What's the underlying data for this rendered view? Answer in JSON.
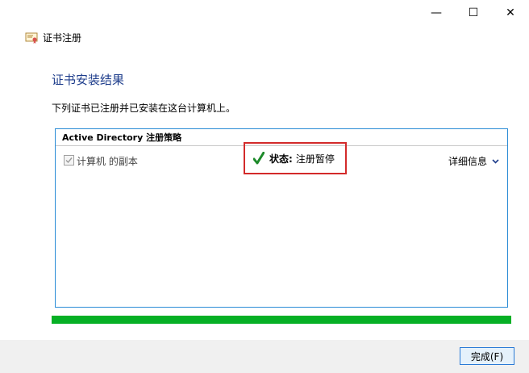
{
  "window": {
    "minimize_glyph": "—",
    "maximize_glyph": "☐",
    "close_glyph": "✕"
  },
  "app": {
    "title": "证书注册",
    "icon": "certificate-icon"
  },
  "heading": "证书安装结果",
  "description": "下列证书已注册并已安装在这台计算机上。",
  "panel": {
    "header": "Active Directory 注册策略",
    "row": {
      "checked": true,
      "label": "计算机 的副本",
      "status_label": "状态:",
      "status_value": "注册暂停",
      "status_icon": "green-checkmark-icon",
      "details_label": "详细信息"
    }
  },
  "progress": {
    "fraction": 1.0,
    "color": "#06b025"
  },
  "footer": {
    "finish_label": "完成(F)"
  }
}
